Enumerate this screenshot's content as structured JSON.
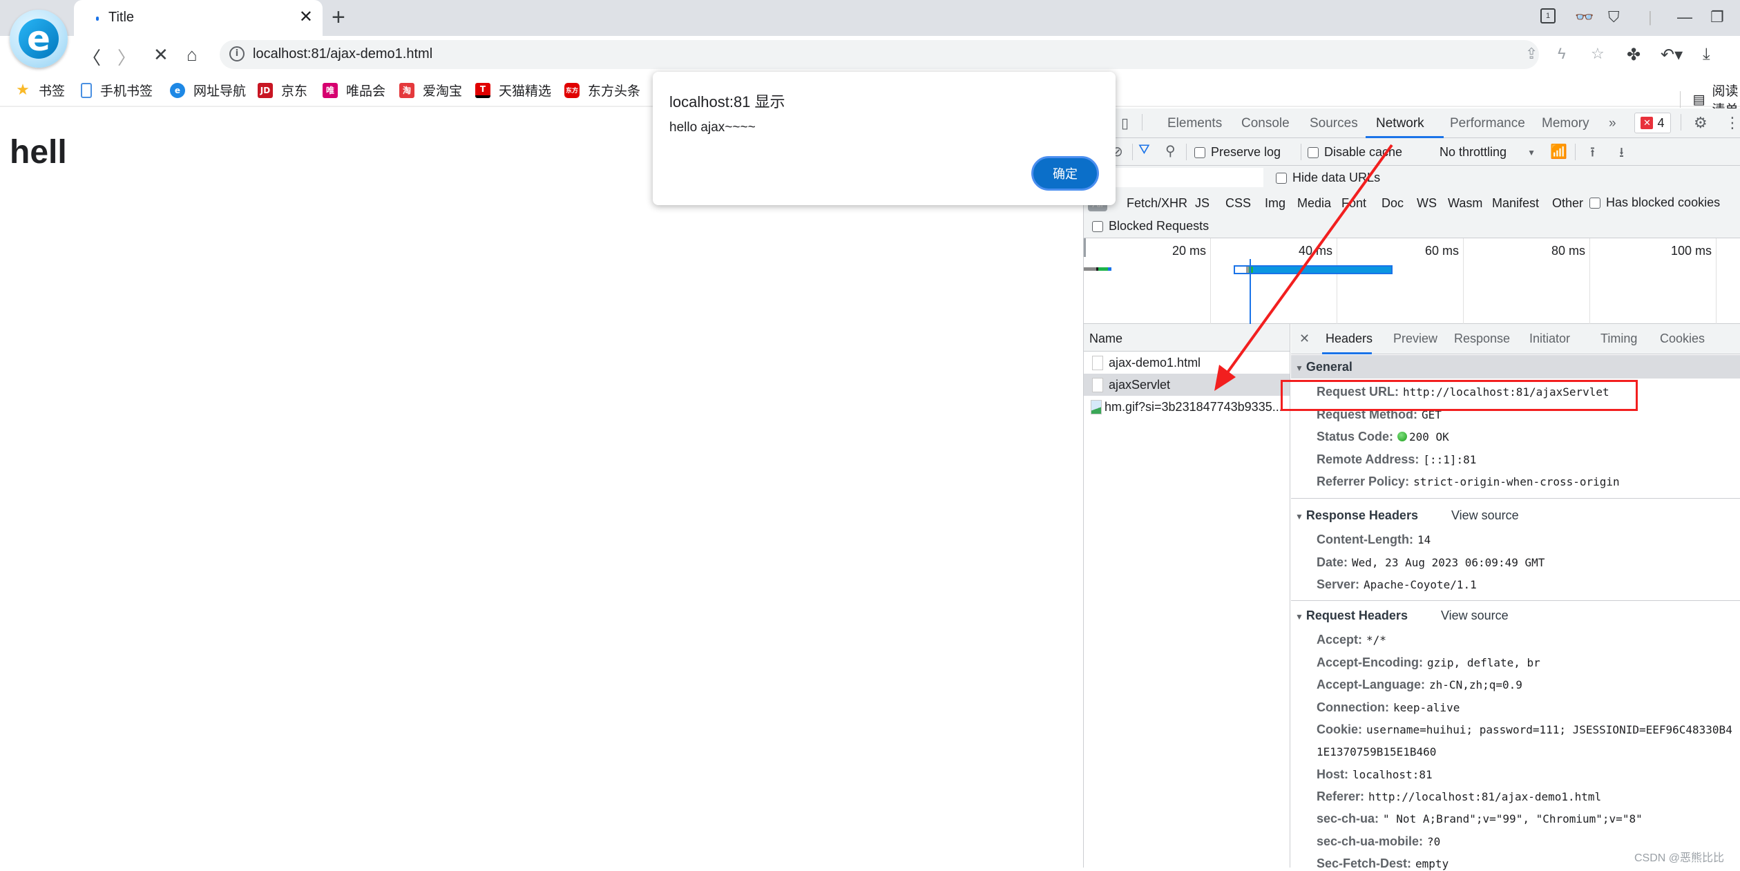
{
  "browser": {
    "tab_title": "Title",
    "address_url": "localhost:81/ajax-demo1.html",
    "window_controls": [
      "tab-count-icon",
      "incognito-icon",
      "skin-icon",
      "minimize-icon",
      "restore-icon"
    ],
    "tab_count": "1"
  },
  "bookmarks": [
    {
      "label": "书签",
      "icon": "star-icon",
      "color": "#f9b928",
      "glyph": "★"
    },
    {
      "label": "手机书签",
      "icon": "mobile-bookmark-icon",
      "color": "#4a90e2",
      "glyph": ""
    },
    {
      "label": "网址导航",
      "icon": "browser-logo-icon",
      "color": "#1e88e5",
      "glyph": "e"
    },
    {
      "label": "京东",
      "icon": "jd-icon",
      "color": "#c81623",
      "glyph": "JD"
    },
    {
      "label": "唯品会",
      "icon": "vip-icon",
      "color": "#d6006f",
      "glyph": "唯"
    },
    {
      "label": "爱淘宝",
      "icon": "taobao-icon",
      "color": "#e4393c",
      "glyph": "淘"
    },
    {
      "label": "天猫精选",
      "icon": "tmall-icon",
      "color": "#e00000",
      "glyph": "T"
    },
    {
      "label": "东方头条",
      "icon": "dftt-icon",
      "color": "#e00000",
      "glyph": "东方"
    }
  ],
  "reading_list": "阅读清单",
  "page": {
    "heading": "hell"
  },
  "dialog": {
    "title": "localhost:81 显示",
    "message": "hello ajax~~~~",
    "ok_label": "确定"
  },
  "devtools": {
    "tabs": [
      "Elements",
      "Console",
      "Sources",
      "Network",
      "Performance",
      "Memory"
    ],
    "active_tab": "Network",
    "more_tabs": "»",
    "error_count": "4",
    "toolbar": {
      "preserve_log": "Preserve log",
      "disable_cache": "Disable cache",
      "throttling": "No throttling"
    },
    "filter": {
      "placeholder": "",
      "hide_data_urls": "Hide data URLs"
    },
    "type_filters": [
      "All",
      "Fetch/XHR",
      "JS",
      "CSS",
      "Img",
      "Media",
      "Font",
      "Doc",
      "WS",
      "Wasm",
      "Manifest",
      "Other"
    ],
    "has_blocked_cookies": "Has blocked cookies",
    "blocked_requests": "Blocked Requests",
    "timeline_labels": [
      "20 ms",
      "40 ms",
      "60 ms",
      "80 ms",
      "100 ms"
    ],
    "name_header": "Name",
    "requests": [
      {
        "name": "ajax-demo1.html",
        "type": "document",
        "selected": false
      },
      {
        "name": "ajaxServlet",
        "type": "xhr",
        "selected": true
      },
      {
        "name": "hm.gif?si=3b231847743b9335...",
        "type": "image",
        "selected": false
      }
    ],
    "detail_tabs": [
      "Headers",
      "Preview",
      "Response",
      "Initiator",
      "Timing",
      "Cookies"
    ],
    "active_detail_tab": "Headers",
    "general": {
      "title": "General",
      "rows": [
        {
          "k": "Request URL:",
          "v": "http://localhost:81/ajaxServlet"
        },
        {
          "k": "Request Method:",
          "v": "GET"
        },
        {
          "k": "Status Code:",
          "v": "200 OK"
        },
        {
          "k": "Remote Address:",
          "v": "[::1]:81"
        },
        {
          "k": "Referrer Policy:",
          "v": "strict-origin-when-cross-origin"
        }
      ]
    },
    "response_headers": {
      "title": "Response Headers",
      "view_source": "View source",
      "rows": [
        {
          "k": "Content-Length:",
          "v": "14"
        },
        {
          "k": "Date:",
          "v": "Wed, 23 Aug 2023 06:09:49 GMT"
        },
        {
          "k": "Server:",
          "v": "Apache-Coyote/1.1"
        }
      ]
    },
    "request_headers": {
      "title": "Request Headers",
      "view_source": "View source",
      "rows": [
        {
          "k": "Accept:",
          "v": "*/*"
        },
        {
          "k": "Accept-Encoding:",
          "v": "gzip, deflate, br"
        },
        {
          "k": "Accept-Language:",
          "v": "zh-CN,zh;q=0.9"
        },
        {
          "k": "Connection:",
          "v": "keep-alive"
        },
        {
          "k": "Cookie:",
          "v": "username=huihui; password=111; JSESSIONID=EEF96C48330B4"
        },
        {
          "k": "",
          "v": "1E1370759B15E1B460"
        },
        {
          "k": "Host:",
          "v": "localhost:81"
        },
        {
          "k": "Referer:",
          "v": "http://localhost:81/ajax-demo1.html"
        },
        {
          "k": "sec-ch-ua:",
          "v": "\" Not A;Brand\";v=\"99\", \"Chromium\";v=\"8\""
        },
        {
          "k": "sec-ch-ua-mobile:",
          "v": "?0"
        },
        {
          "k": "Sec-Fetch-Dest:",
          "v": "empty"
        }
      ]
    }
  },
  "annotation": {
    "highlight_color": "#f21f1f"
  },
  "watermark": "CSDN @恶熊比比"
}
